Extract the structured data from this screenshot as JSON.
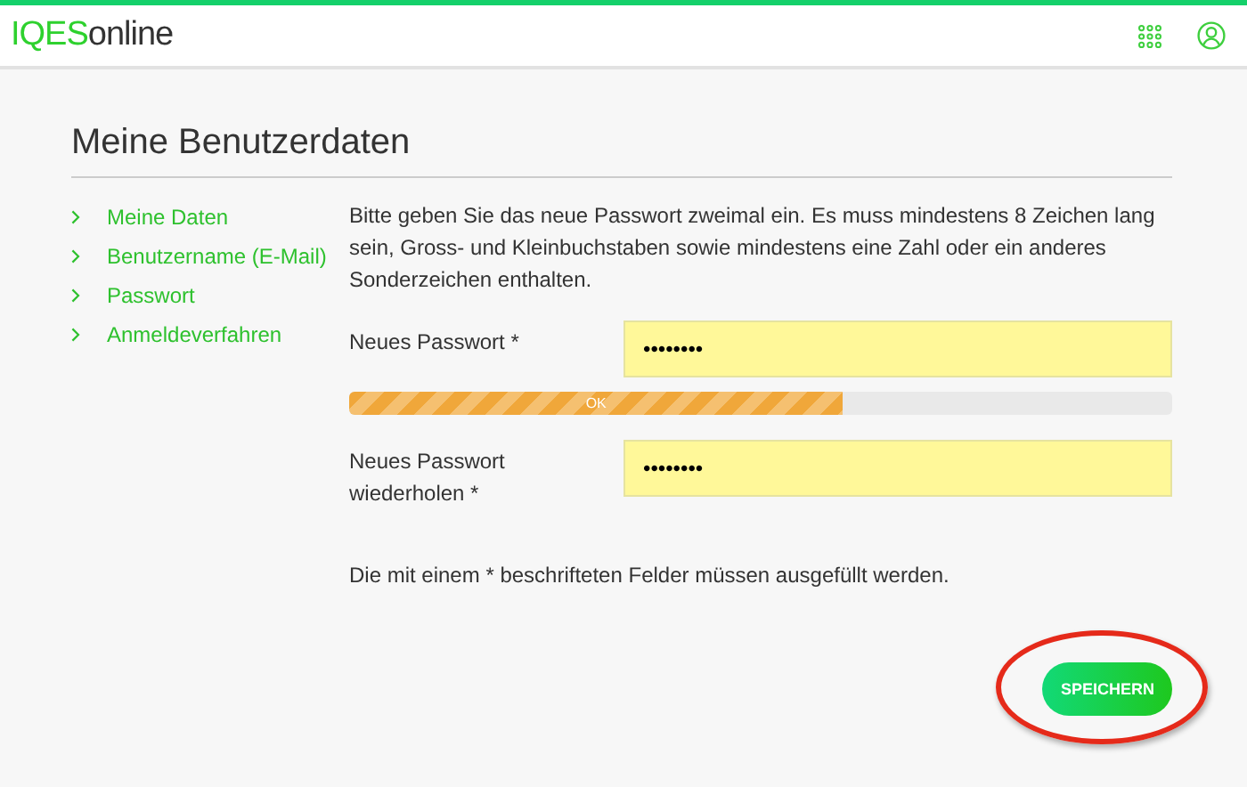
{
  "header": {
    "logo_brand": "IQES",
    "logo_suffix": "online"
  },
  "page_title": "Meine Benutzerdaten",
  "sidebar": {
    "items": [
      {
        "label": "Meine Daten"
      },
      {
        "label": "Benutzername (E-Mail)"
      },
      {
        "label": "Passwort"
      },
      {
        "label": "Anmeldeverfahren"
      }
    ]
  },
  "intro": "Bitte geben Sie das neue Passwort zweimal ein. Es muss mindestens 8 Zeichen lang sein, Gross- und Kleinbuchstaben sowie mindestens eine Zahl oder ein anderes Sonderzeichen enthalten.",
  "fields": [
    {
      "label": "Neues Passwort *",
      "value": "••••••••"
    },
    {
      "label": "Neues Passwort wiederholen *",
      "value": "••••••••"
    }
  ],
  "strength": {
    "level": 0.6,
    "label": "OK"
  },
  "required_note": "Die mit einem * beschrifteten Felder müssen ausgefüllt werden.",
  "save_button": {
    "label": "SPEICHERN",
    "highlighted": true
  }
}
